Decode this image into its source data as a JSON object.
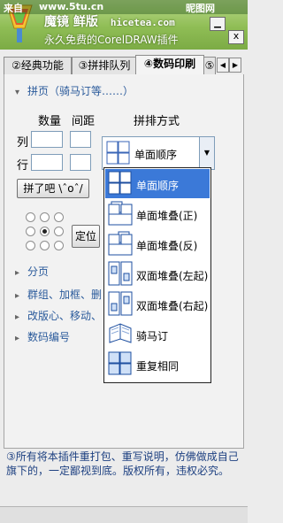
{
  "watermark": {
    "left": "来自",
    "url": "www.5tu.cn",
    "right": "昵图网"
  },
  "window": {
    "title": "魔镜 鲜版",
    "site": "hicetea.com",
    "subtitle": "永久免费的CorelDRAW插件",
    "minimize_icon": "minimize-icon",
    "close_label": "x"
  },
  "tabs": [
    {
      "label": "②经典功能"
    },
    {
      "label": "③拼排队列"
    },
    {
      "label": "④数码印刷",
      "active": true
    },
    {
      "label": "⑤"
    }
  ],
  "tab_scroll": {
    "left": "◀",
    "right": "▶"
  },
  "imposition": {
    "header": "拼页（骑马订等……）",
    "col_quantity": "数量",
    "col_spacing": "间距",
    "col_method": "拼排方式",
    "row_columns": "列",
    "row_rows": "行",
    "go_button": "拼了吧 \\ˆoˆ/",
    "position_button": "定位",
    "selected_method": "单面顺序"
  },
  "method_options": [
    {
      "label": "单面顺序",
      "selected": true,
      "icon": "single-sequence-icon"
    },
    {
      "label": "单面堆叠(正)",
      "icon": "single-stack-forward-icon"
    },
    {
      "label": "单面堆叠(反)",
      "icon": "single-stack-reverse-icon"
    },
    {
      "label": "双面堆叠(左起)",
      "icon": "double-stack-left-icon"
    },
    {
      "label": "双面堆叠(右起)",
      "icon": "double-stack-right-icon"
    },
    {
      "label": "骑马订",
      "icon": "saddle-stitch-icon"
    },
    {
      "label": "重复相同",
      "icon": "repeat-same-icon"
    }
  ],
  "sections": [
    {
      "label": "分页"
    },
    {
      "label": "群组、加框、删"
    },
    {
      "label": "改版心、移动、"
    },
    {
      "label": "数码编号"
    }
  ],
  "footer": {
    "text": "③所有将本插件重打包、重写说明，仿佛做成自己旗下的，一定鄙视到底。版权所有，违权必究。"
  },
  "colors": {
    "title_bg": "#8fbd55",
    "selection": "#3b79d8",
    "section_link": "#2a5a9b",
    "footer_text": "#1c3f80"
  }
}
